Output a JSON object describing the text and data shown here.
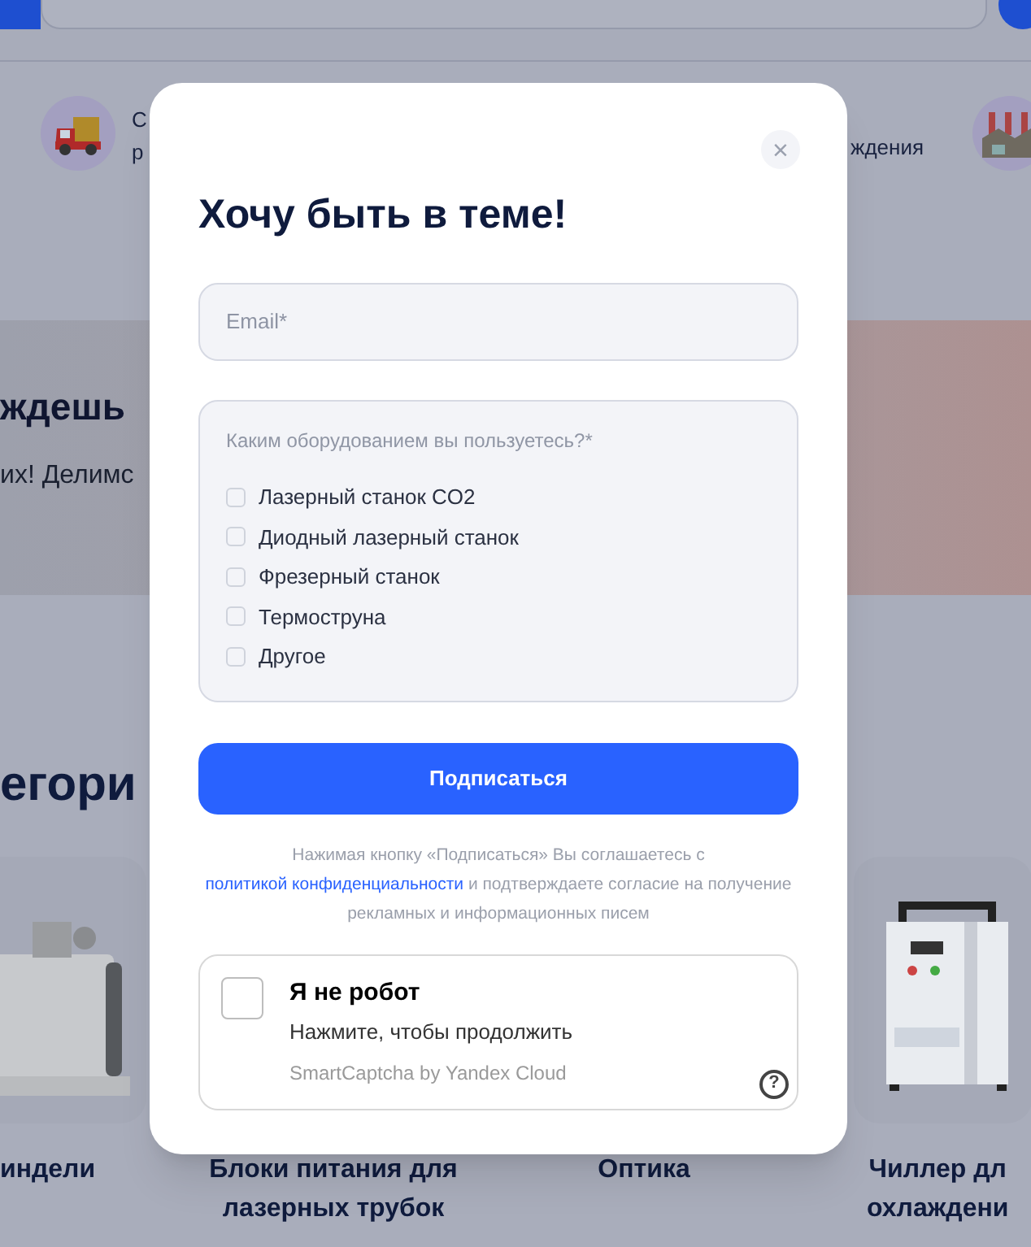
{
  "background": {
    "features": [
      {
        "lines": [
          "С",
          "р"
        ]
      },
      {
        "lines": [
          "ждения"
        ]
      }
    ],
    "banner": {
      "title": "ждешь",
      "text": "их! Делимс"
    },
    "section_title": "егори",
    "categories": [
      {
        "lines": [
          "индели"
        ],
        "kind": "picture"
      },
      {
        "lines": [
          "Блоки питания для",
          "лазерных трубок"
        ]
      },
      {
        "lines": [
          "Оптика"
        ]
      },
      {
        "lines": [
          "Чиллер дл",
          "охлаждени"
        ],
        "kind": "picture"
      }
    ]
  },
  "modal": {
    "close": "×",
    "title": "Хочу быть в теме!",
    "email": {
      "placeholder": "Email*"
    },
    "equipment": {
      "question": "Каким оборудованием вы пользуетесь?*",
      "options": [
        {
          "label": "Лазерный станок CO2",
          "checked": false
        },
        {
          "label": "Диодный лазерный станок",
          "checked": false
        },
        {
          "label": "Фрезерный станок",
          "checked": false
        },
        {
          "label": "Термоструна",
          "checked": false
        },
        {
          "label": "Другое",
          "checked": false
        }
      ]
    },
    "submit": "Подписаться",
    "consent": {
      "before": "Нажимая кнопку «Подписаться» Вы соглашаетесь с",
      "link": "политикой конфиденциальности",
      "after": "и подтверждаете согласие на получение рекламных и информационных писем"
    },
    "captcha": {
      "checked": false,
      "title": "Я не робот",
      "subtitle": "Нажмите, чтобы продолжить",
      "brand": "SmartCaptcha by Yandex Cloud",
      "help": "?"
    }
  }
}
